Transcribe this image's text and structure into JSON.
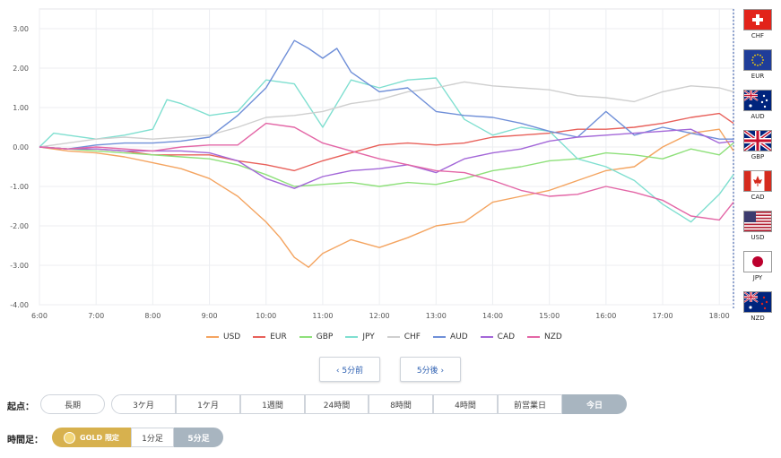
{
  "chart_data": {
    "type": "line",
    "yticks": [
      "3.00",
      "2.00",
      "1.00",
      "0.00",
      "-1.00",
      "-2.00",
      "-3.00",
      "-4.00"
    ],
    "ylim": [
      -4,
      3.5
    ],
    "xticks": [
      "6:00",
      "7:00",
      "8:00",
      "9:00",
      "10:00",
      "11:00",
      "12:00",
      "13:00",
      "14:00",
      "15:00",
      "16:00",
      "17:00",
      "18:00"
    ],
    "xlim": [
      6.0,
      18.25
    ],
    "grid": true,
    "legend_position": "bottom",
    "series": [
      {
        "name": "USD",
        "color": "#f4a460",
        "points": [
          [
            6,
            0
          ],
          [
            6.5,
            -0.1
          ],
          [
            7,
            -0.15
          ],
          [
            7.5,
            -0.25
          ],
          [
            8,
            -0.4
          ],
          [
            8.5,
            -0.55
          ],
          [
            9,
            -0.8
          ],
          [
            9.5,
            -1.25
          ],
          [
            10,
            -1.9
          ],
          [
            10.25,
            -2.3
          ],
          [
            10.5,
            -2.8
          ],
          [
            10.75,
            -3.05
          ],
          [
            11,
            -2.7
          ],
          [
            11.5,
            -2.35
          ],
          [
            12,
            -2.55
          ],
          [
            12.5,
            -2.3
          ],
          [
            13,
            -2.0
          ],
          [
            13.5,
            -1.9
          ],
          [
            14,
            -1.4
          ],
          [
            14.5,
            -1.25
          ],
          [
            15,
            -1.1
          ],
          [
            15.5,
            -0.85
          ],
          [
            16,
            -0.6
          ],
          [
            16.5,
            -0.5
          ],
          [
            17,
            0.0
          ],
          [
            17.5,
            0.35
          ],
          [
            18,
            0.45
          ],
          [
            18.25,
            -0.1
          ]
        ]
      },
      {
        "name": "EUR",
        "color": "#e8605a",
        "points": [
          [
            6,
            0
          ],
          [
            6.5,
            -0.05
          ],
          [
            7,
            -0.05
          ],
          [
            7.5,
            -0.1
          ],
          [
            8,
            -0.2
          ],
          [
            8.5,
            -0.2
          ],
          [
            9,
            -0.2
          ],
          [
            9.5,
            -0.35
          ],
          [
            10,
            -0.45
          ],
          [
            10.5,
            -0.6
          ],
          [
            11,
            -0.35
          ],
          [
            11.5,
            -0.15
          ],
          [
            12,
            0.05
          ],
          [
            12.5,
            0.1
          ],
          [
            13,
            0.05
          ],
          [
            13.5,
            0.1
          ],
          [
            14,
            0.25
          ],
          [
            14.5,
            0.3
          ],
          [
            15,
            0.35
          ],
          [
            15.5,
            0.45
          ],
          [
            16,
            0.45
          ],
          [
            16.5,
            0.5
          ],
          [
            17,
            0.6
          ],
          [
            17.5,
            0.75
          ],
          [
            18,
            0.85
          ],
          [
            18.25,
            0.6
          ]
        ]
      },
      {
        "name": "GBP",
        "color": "#8ee07a",
        "points": [
          [
            6,
            0
          ],
          [
            6.5,
            -0.05
          ],
          [
            7,
            -0.1
          ],
          [
            7.5,
            -0.15
          ],
          [
            8,
            -0.2
          ],
          [
            8.5,
            -0.25
          ],
          [
            9,
            -0.3
          ],
          [
            9.5,
            -0.45
          ],
          [
            10,
            -0.7
          ],
          [
            10.5,
            -1.0
          ],
          [
            11,
            -0.95
          ],
          [
            11.5,
            -0.9
          ],
          [
            12,
            -1.0
          ],
          [
            12.5,
            -0.9
          ],
          [
            13,
            -0.95
          ],
          [
            13.5,
            -0.8
          ],
          [
            14,
            -0.6
          ],
          [
            14.5,
            -0.5
          ],
          [
            15,
            -0.35
          ],
          [
            15.5,
            -0.3
          ],
          [
            16,
            -0.15
          ],
          [
            16.5,
            -0.2
          ],
          [
            17,
            -0.3
          ],
          [
            17.5,
            -0.05
          ],
          [
            18,
            -0.2
          ],
          [
            18.25,
            0.1
          ]
        ]
      },
      {
        "name": "JPY",
        "color": "#7fdfd0",
        "points": [
          [
            6,
            0
          ],
          [
            6.25,
            0.35
          ],
          [
            6.5,
            0.3
          ],
          [
            7,
            0.2
          ],
          [
            7.5,
            0.3
          ],
          [
            8,
            0.45
          ],
          [
            8.25,
            1.2
          ],
          [
            8.5,
            1.1
          ],
          [
            9,
            0.8
          ],
          [
            9.5,
            0.9
          ],
          [
            10,
            1.7
          ],
          [
            10.5,
            1.6
          ],
          [
            11,
            0.5
          ],
          [
            11.5,
            1.7
          ],
          [
            12,
            1.5
          ],
          [
            12.5,
            1.7
          ],
          [
            13,
            1.75
          ],
          [
            13.5,
            0.7
          ],
          [
            14,
            0.3
          ],
          [
            14.5,
            0.5
          ],
          [
            15,
            0.4
          ],
          [
            15.5,
            -0.3
          ],
          [
            16,
            -0.5
          ],
          [
            16.5,
            -0.85
          ],
          [
            17,
            -1.45
          ],
          [
            17.5,
            -1.9
          ],
          [
            18,
            -1.2
          ],
          [
            18.25,
            -0.7
          ]
        ]
      },
      {
        "name": "CHF",
        "color": "#cfcfcf",
        "points": [
          [
            6,
            0
          ],
          [
            6.5,
            0.1
          ],
          [
            7,
            0.2
          ],
          [
            7.5,
            0.25
          ],
          [
            8,
            0.2
          ],
          [
            8.5,
            0.25
          ],
          [
            9,
            0.3
          ],
          [
            9.5,
            0.5
          ],
          [
            10,
            0.75
          ],
          [
            10.5,
            0.8
          ],
          [
            11,
            0.9
          ],
          [
            11.5,
            1.1
          ],
          [
            12,
            1.2
          ],
          [
            12.5,
            1.4
          ],
          [
            13,
            1.5
          ],
          [
            13.5,
            1.65
          ],
          [
            14,
            1.55
          ],
          [
            14.5,
            1.5
          ],
          [
            15,
            1.45
          ],
          [
            15.5,
            1.3
          ],
          [
            16,
            1.25
          ],
          [
            16.5,
            1.15
          ],
          [
            17,
            1.4
          ],
          [
            17.5,
            1.55
          ],
          [
            18,
            1.5
          ],
          [
            18.25,
            1.4
          ]
        ]
      },
      {
        "name": "AUD",
        "color": "#6f8fd8",
        "points": [
          [
            6,
            0
          ],
          [
            6.5,
            -0.05
          ],
          [
            7,
            0.05
          ],
          [
            7.5,
            0.1
          ],
          [
            8,
            0.1
          ],
          [
            8.5,
            0.15
          ],
          [
            9,
            0.25
          ],
          [
            9.5,
            0.8
          ],
          [
            10,
            1.5
          ],
          [
            10.25,
            2.1
          ],
          [
            10.5,
            2.7
          ],
          [
            10.75,
            2.5
          ],
          [
            11,
            2.25
          ],
          [
            11.25,
            2.5
          ],
          [
            11.5,
            1.9
          ],
          [
            12,
            1.4
          ],
          [
            12.5,
            1.5
          ],
          [
            13,
            0.9
          ],
          [
            13.5,
            0.8
          ],
          [
            14,
            0.75
          ],
          [
            14.5,
            0.6
          ],
          [
            15,
            0.4
          ],
          [
            15.5,
            0.25
          ],
          [
            16,
            0.9
          ],
          [
            16.5,
            0.3
          ],
          [
            17,
            0.5
          ],
          [
            17.5,
            0.35
          ],
          [
            18,
            0.2
          ],
          [
            18.25,
            0.2
          ]
        ]
      },
      {
        "name": "CAD",
        "color": "#a367d8",
        "points": [
          [
            6,
            0
          ],
          [
            6.5,
            -0.05
          ],
          [
            7,
            -0.05
          ],
          [
            7.5,
            -0.1
          ],
          [
            8,
            -0.1
          ],
          [
            8.5,
            -0.1
          ],
          [
            9,
            -0.15
          ],
          [
            9.5,
            -0.35
          ],
          [
            10,
            -0.8
          ],
          [
            10.5,
            -1.05
          ],
          [
            11,
            -0.75
          ],
          [
            11.5,
            -0.6
          ],
          [
            12,
            -0.55
          ],
          [
            12.5,
            -0.45
          ],
          [
            13,
            -0.65
          ],
          [
            13.5,
            -0.3
          ],
          [
            14,
            -0.15
          ],
          [
            14.5,
            -0.05
          ],
          [
            15,
            0.15
          ],
          [
            15.5,
            0.25
          ],
          [
            16,
            0.3
          ],
          [
            16.5,
            0.35
          ],
          [
            17,
            0.4
          ],
          [
            17.5,
            0.45
          ],
          [
            18,
            0.1
          ],
          [
            18.25,
            0.15
          ]
        ]
      },
      {
        "name": "NZD",
        "color": "#e366a6",
        "points": [
          [
            6,
            0
          ],
          [
            6.5,
            -0.05
          ],
          [
            7,
            0.0
          ],
          [
            7.5,
            -0.05
          ],
          [
            8,
            -0.1
          ],
          [
            8.5,
            0.0
          ],
          [
            9,
            0.05
          ],
          [
            9.5,
            0.05
          ],
          [
            10,
            0.6
          ],
          [
            10.5,
            0.5
          ],
          [
            11,
            0.1
          ],
          [
            11.5,
            -0.1
          ],
          [
            12,
            -0.3
          ],
          [
            12.5,
            -0.45
          ],
          [
            13,
            -0.6
          ],
          [
            13.5,
            -0.65
          ],
          [
            14,
            -0.85
          ],
          [
            14.5,
            -1.1
          ],
          [
            15,
            -1.25
          ],
          [
            15.5,
            -1.2
          ],
          [
            16,
            -1.0
          ],
          [
            16.5,
            -1.15
          ],
          [
            17,
            -1.35
          ],
          [
            17.5,
            -1.75
          ],
          [
            18,
            -1.85
          ],
          [
            18.25,
            -1.4
          ]
        ]
      }
    ]
  },
  "flags": [
    {
      "code": "CHF",
      "icon": "swiss-flag-icon"
    },
    {
      "code": "EUR",
      "icon": "eu-flag-icon"
    },
    {
      "code": "AUD",
      "icon": "australia-flag-icon"
    },
    {
      "code": "GBP",
      "icon": "uk-flag-icon"
    },
    {
      "code": "CAD",
      "icon": "canada-flag-icon"
    },
    {
      "code": "USD",
      "icon": "usa-flag-icon"
    },
    {
      "code": "JPY",
      "icon": "japan-flag-icon"
    },
    {
      "code": "NZD",
      "icon": "new-zealand-flag-icon"
    }
  ],
  "nav": {
    "prev_label": "‹ 5分前",
    "next_label": "5分後 ›"
  },
  "start_point": {
    "label": "起点：",
    "options": [
      "長期",
      "3ケ月",
      "1ケ月",
      "1週間",
      "24時間",
      "8時間",
      "4時間",
      "前営業日",
      "今日"
    ],
    "selected": "今日"
  },
  "timeframe": {
    "label": "時間足：",
    "gold_label": "GOLD 限定",
    "options": [
      "1分足",
      "5分足"
    ],
    "selected": "5分足"
  }
}
